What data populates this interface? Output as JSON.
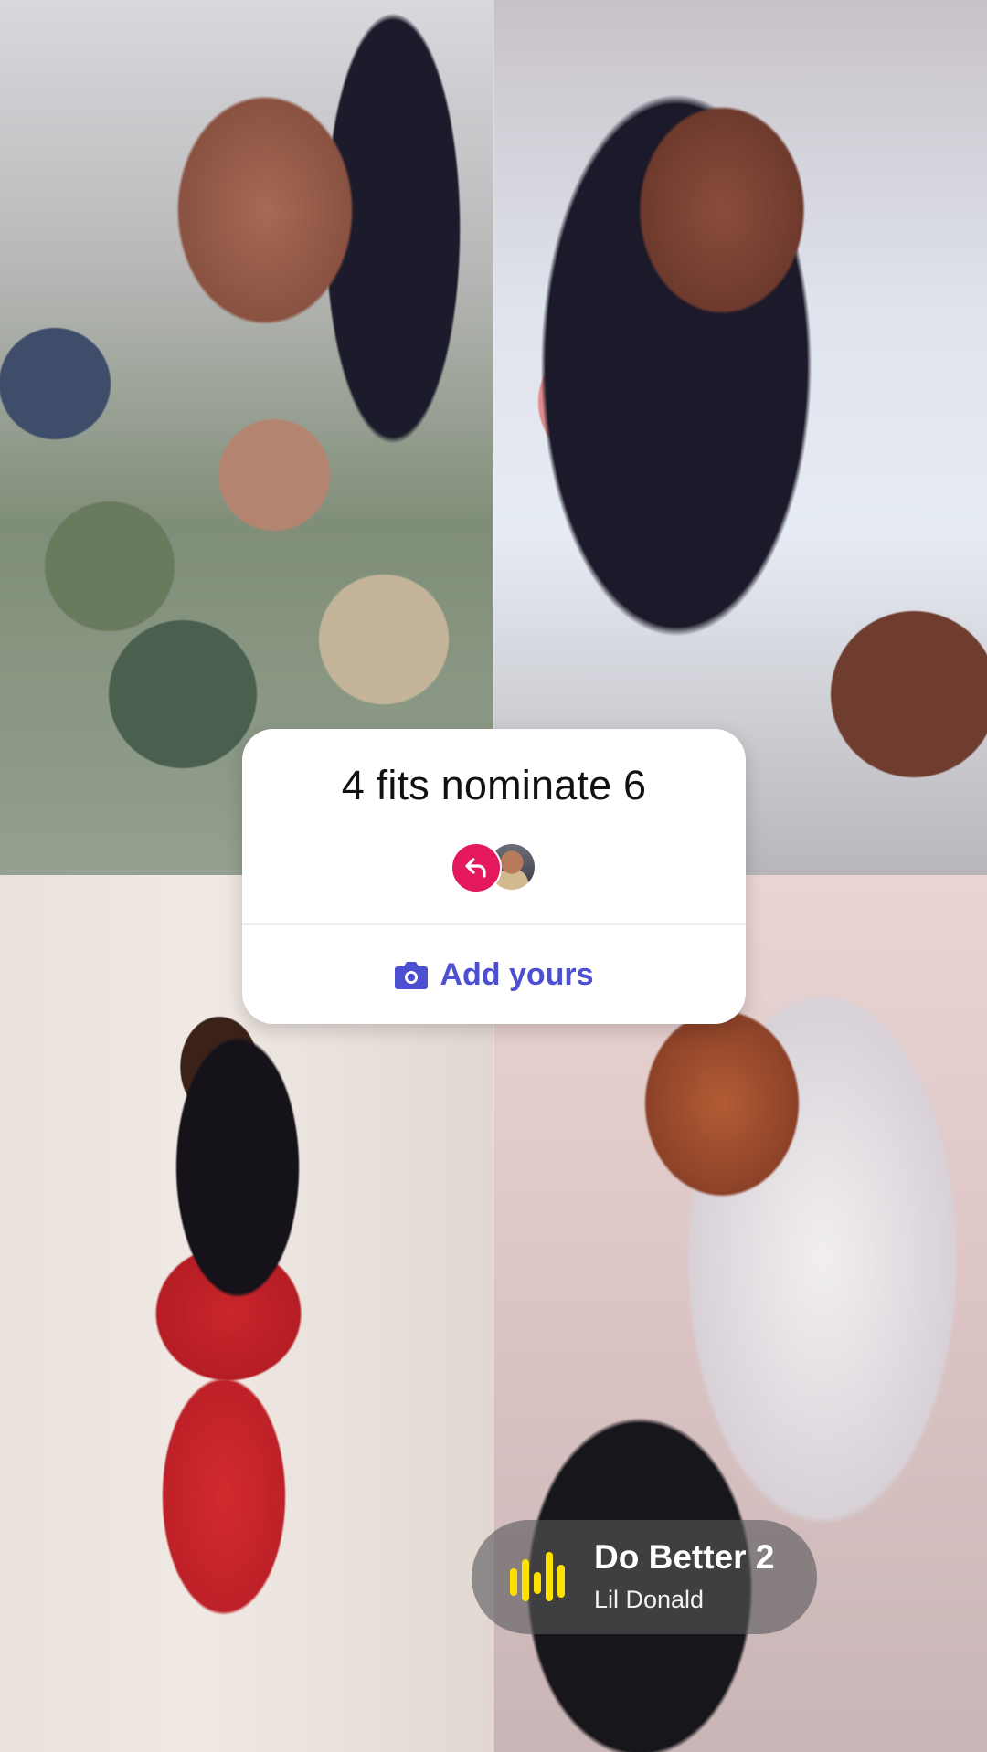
{
  "sticker": {
    "title": "4 fits nominate 6",
    "button_label": "Add yours",
    "button_icon": "camera-icon",
    "reply_icon": "reply-arrow-icon",
    "accent": "#4c4fcf",
    "reply_color": "#e4185f"
  },
  "music": {
    "title": "Do Better 2",
    "artist": "Lil Donald",
    "icon": "music-bars-icon",
    "icon_color": "#ffe100"
  }
}
